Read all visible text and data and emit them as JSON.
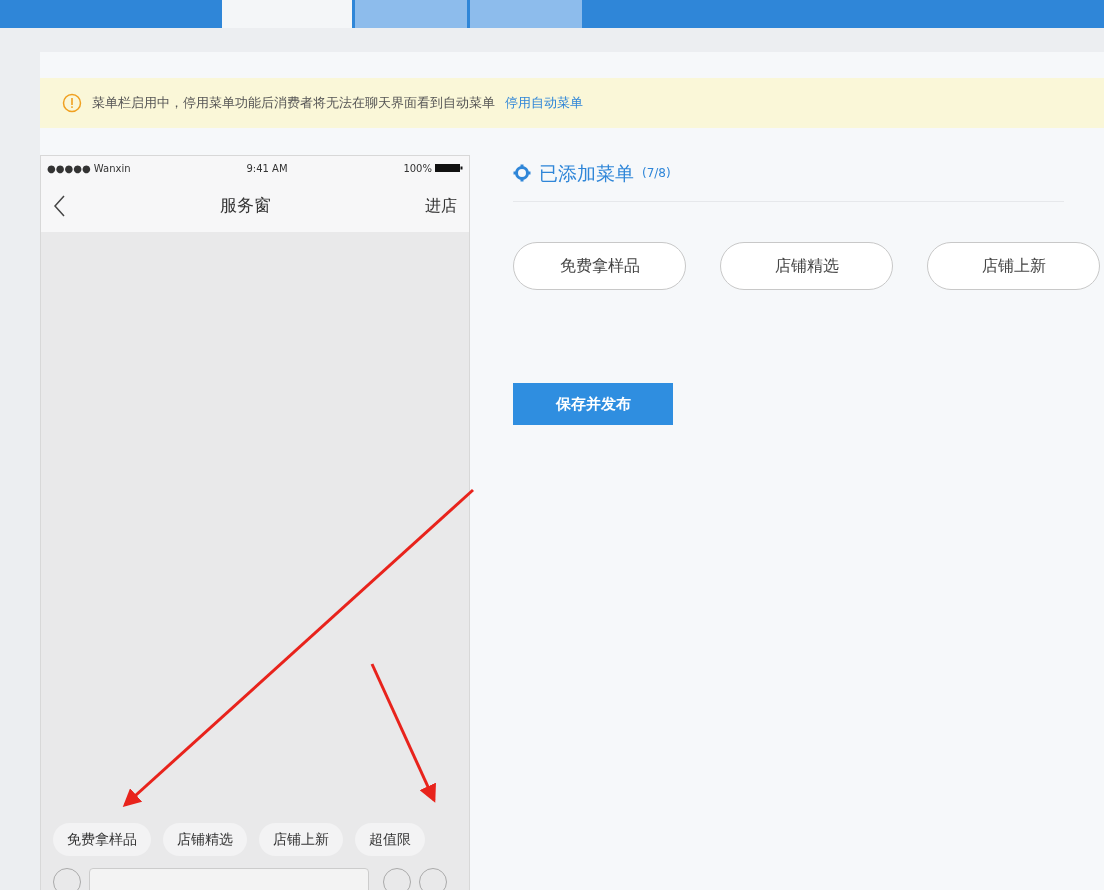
{
  "tabs": [
    {
      "selected": true
    },
    {
      "selected": false
    },
    {
      "selected": false
    }
  ],
  "notice": {
    "text": "菜单栏启用中，停用菜单功能后消费者将无法在聊天界面看到自动菜单",
    "link": "停用自动菜单"
  },
  "phone": {
    "status_bar": {
      "carrier": "●●●●● Wanxin",
      "time": "9:41 AM",
      "battery": "100%"
    },
    "nav": {
      "title": "服务窗",
      "action": "进店"
    },
    "menu_chips": [
      "免费拿样品",
      "店铺精选",
      "店铺上新",
      "超值限"
    ]
  },
  "menu_panel": {
    "title": "已添加菜单",
    "count": "(7/8)",
    "items": [
      "免费拿样品",
      "店铺精选",
      "店铺上新"
    ],
    "save_button": "保存并发布"
  }
}
